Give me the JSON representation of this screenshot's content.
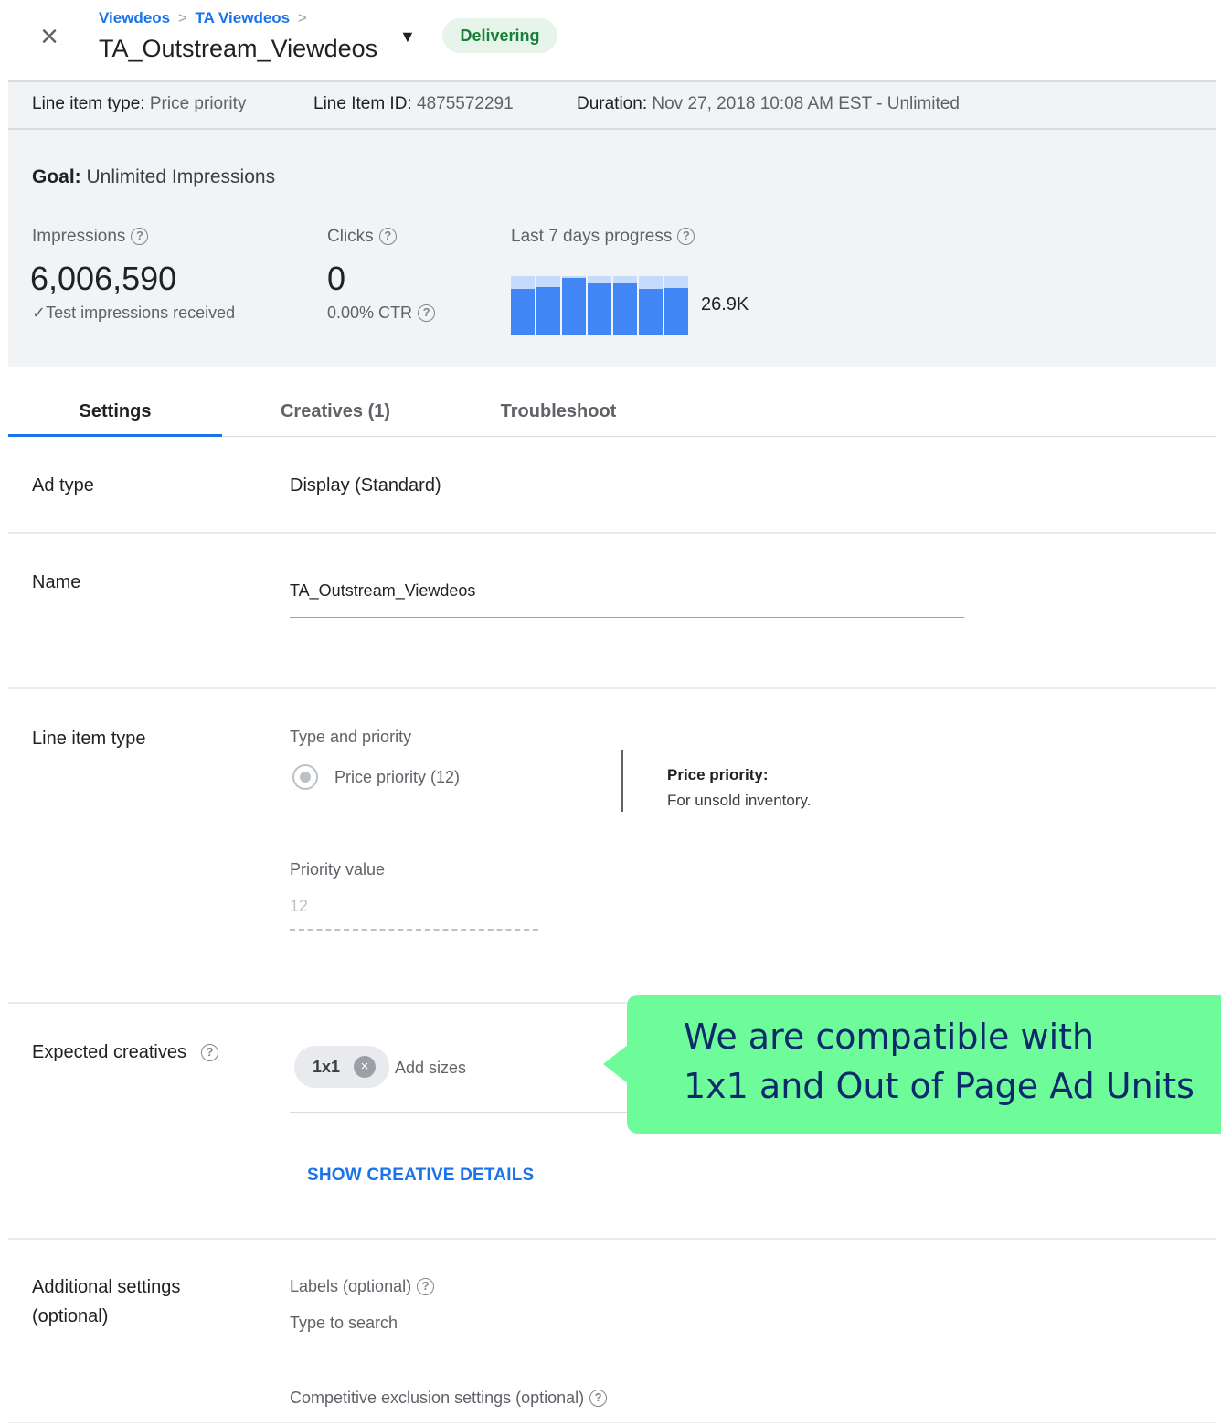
{
  "header": {
    "breadcrumb": [
      "Viewdeos",
      "TA Viewdeos"
    ],
    "breadcrumb_sep": ">",
    "title": "TA_Outstream_Viewdeos",
    "status": "Delivering",
    "close_icon": "close-icon",
    "caret_icon": "caret-down-icon"
  },
  "infobar": {
    "type_key": "Line item type:",
    "type_val": "Price priority",
    "id_key": "Line Item ID:",
    "id_val": "4875572291",
    "duration_key": "Duration:",
    "duration_val": "Nov 27, 2018 10:08 AM EST - Unlimited"
  },
  "stats": {
    "goal_key": "Goal:",
    "goal_val": "Unlimited Impressions",
    "impressions_label": "Impressions",
    "impressions_value": "6,006,590",
    "impressions_sub": "✓Test impressions received",
    "clicks_label": "Clicks",
    "clicks_value": "0",
    "clicks_sub": "0.00% CTR",
    "progress_label": "Last 7 days progress",
    "progress_total": "26.9K",
    "progress_bars": [
      0.78,
      0.82,
      0.97,
      0.88,
      0.88,
      0.78,
      0.8
    ],
    "help_icon": "help-circle-icon"
  },
  "tabs": [
    "Settings",
    "Creatives (1)",
    "Troubleshoot"
  ],
  "settings": {
    "ad_type_label": "Ad type",
    "ad_type_value": "Display (Standard)",
    "name_label": "Name",
    "name_value": "TA_Outstream_Viewdeos",
    "line_item_type_label": "Line item type",
    "type_priority_label": "Type and priority",
    "radio_label": "Price priority (12)",
    "priority_desc_title": "Price priority:",
    "priority_desc_text": "For unsold inventory.",
    "priority_value_label": "Priority value",
    "priority_value": "12",
    "expected_creatives_label": "Expected creatives",
    "chip_size": "1x1",
    "add_sizes_placeholder": "Add sizes",
    "show_details": "SHOW CREATIVE DETAILS",
    "additional_label_1": "Additional settings",
    "additional_label_2": "(optional)",
    "labels_label": "Labels (optional)",
    "labels_placeholder": "Type to search",
    "competitive_label": "Competitive exclusion settings (optional)"
  },
  "callout": {
    "line1": "We are compatible with",
    "line2": "1x1 and Out of Page Ad Units"
  },
  "colors": {
    "accent": "#1a73e8",
    "status_bg": "#e6f4ea",
    "status_text": "#188038",
    "callout_bg": "#6efc9b",
    "callout_text": "#0b2a6b",
    "bar": "#4285f4"
  }
}
